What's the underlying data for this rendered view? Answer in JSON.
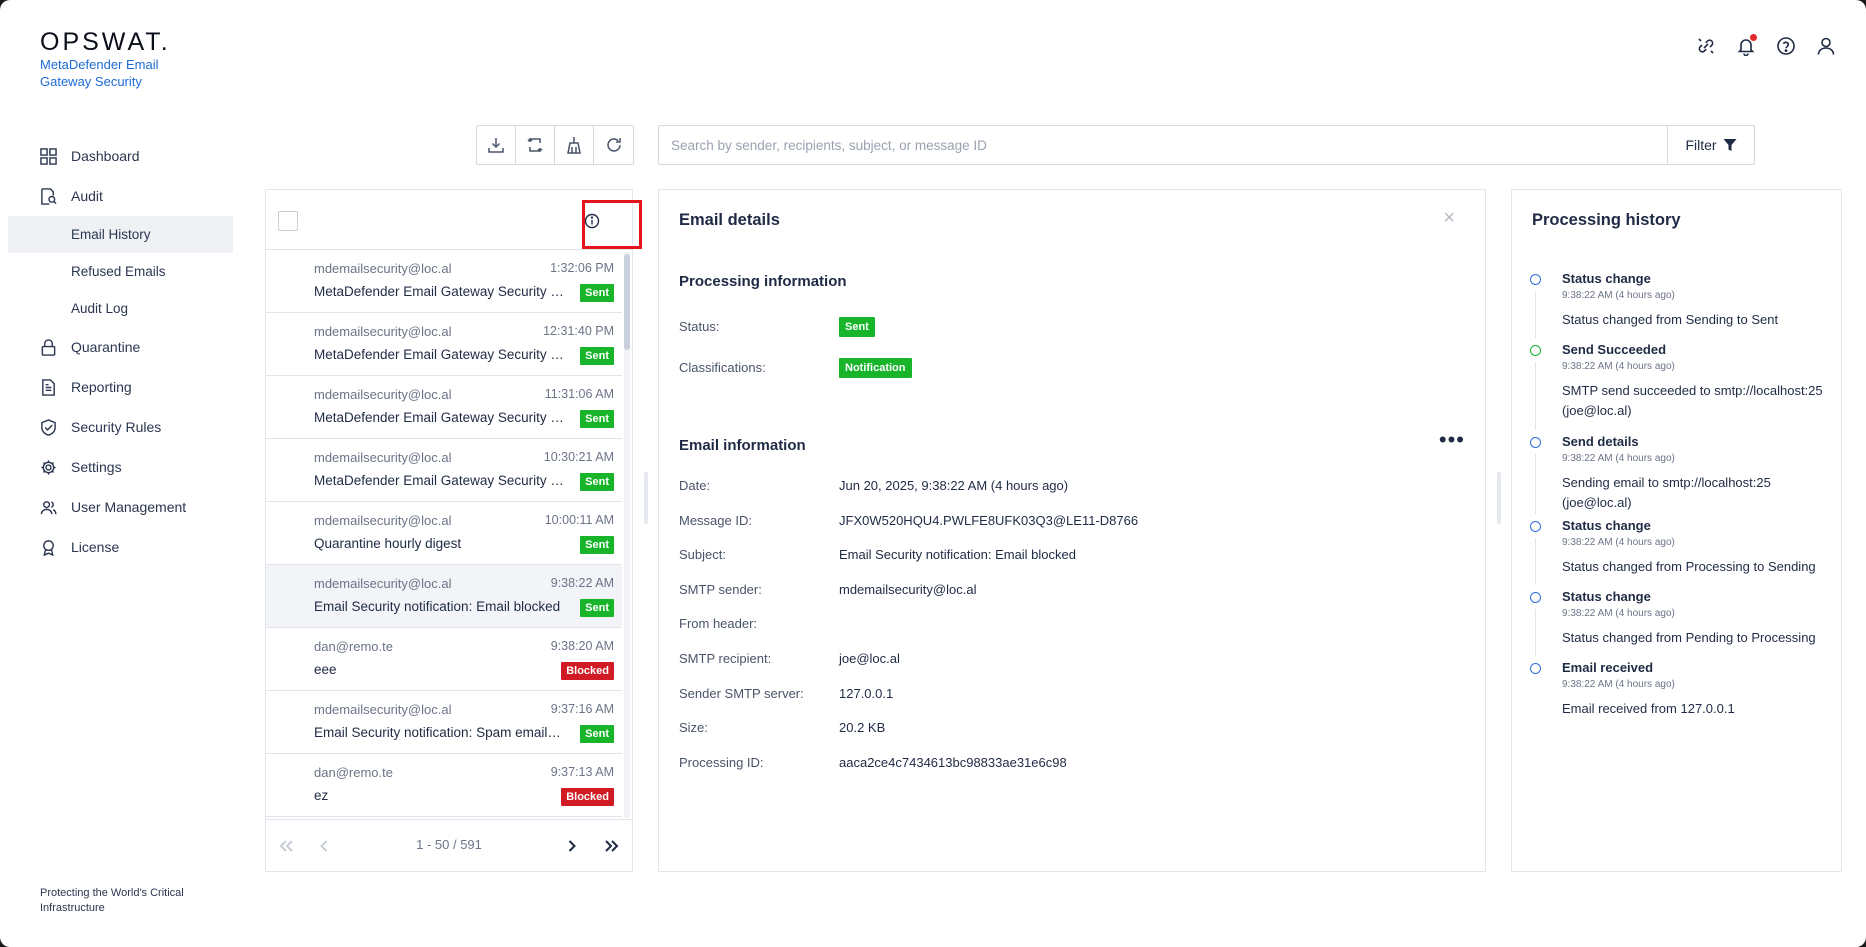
{
  "brand": {
    "logo": "OPSWAT",
    "logo_dot": ".",
    "product": "MetaDefender Email Gateway Security",
    "tagline": "Protecting the World's Critical Infrastructure"
  },
  "nav": {
    "dashboard": "Dashboard",
    "audit": "Audit",
    "email_history": "Email History",
    "refused_emails": "Refused Emails",
    "audit_log": "Audit Log",
    "quarantine": "Quarantine",
    "reporting": "Reporting",
    "security_rules": "Security Rules",
    "settings": "Settings",
    "user_management": "User Management",
    "license": "License"
  },
  "search": {
    "placeholder": "Search by sender, recipients, subject, or message ID",
    "filter_label": "Filter"
  },
  "emails": [
    {
      "from": "mdemailsecurity@loc.al",
      "time": "1:32:06 PM",
      "subject": "MetaDefender Email Gateway Security report",
      "status": "Sent"
    },
    {
      "from": "mdemailsecurity@loc.al",
      "time": "12:31:40 PM",
      "subject": "MetaDefender Email Gateway Security report",
      "status": "Sent"
    },
    {
      "from": "mdemailsecurity@loc.al",
      "time": "11:31:06 AM",
      "subject": "MetaDefender Email Gateway Security report",
      "status": "Sent"
    },
    {
      "from": "mdemailsecurity@loc.al",
      "time": "10:30:21 AM",
      "subject": "MetaDefender Email Gateway Security report",
      "status": "Sent"
    },
    {
      "from": "mdemailsecurity@loc.al",
      "time": "10:00:11 AM",
      "subject": "Quarantine hourly digest",
      "status": "Sent"
    },
    {
      "from": "mdemailsecurity@loc.al",
      "time": "9:38:22 AM",
      "subject": "Email Security notification: Email blocked",
      "status": "Sent"
    },
    {
      "from": "dan@remo.te",
      "time": "9:38:20 AM",
      "subject": "eee",
      "status": "Blocked"
    },
    {
      "from": "mdemailsecurity@loc.al",
      "time": "9:37:16 AM",
      "subject": "Email Security notification: Spam email detected",
      "status": "Sent"
    },
    {
      "from": "dan@remo.te",
      "time": "9:37:13 AM",
      "subject": "ez",
      "status": "Blocked"
    }
  ],
  "pager": {
    "count": "1 - 50 / 591"
  },
  "details": {
    "title": "Email details",
    "processing_title": "Processing information",
    "status_label": "Status:",
    "status_value": "Sent",
    "class_label": "Classifications:",
    "class_value": "Notification",
    "email_info_title": "Email information",
    "more": "•••",
    "fields": [
      {
        "label": "Date:",
        "value": "Jun 20, 2025, 9:38:22 AM (4 hours ago)"
      },
      {
        "label": "Message ID:",
        "value": "JFX0W520HQU4.PWLFE8UFK03Q3@LE11-D8766"
      },
      {
        "label": "Subject:",
        "value": "Email Security notification: Email blocked"
      },
      {
        "label": "SMTP sender:",
        "value": "mdemailsecurity@loc.al"
      },
      {
        "label": "From header:",
        "value": ""
      },
      {
        "label": "SMTP recipient:",
        "value": "joe@loc.al"
      },
      {
        "label": "Sender SMTP server:",
        "value": "127.0.0.1"
      },
      {
        "label": "Size:",
        "value": "20.2 KB"
      },
      {
        "label": "Processing ID:",
        "value": "aaca2ce4c7434613bc98833ae31e6c98"
      }
    ]
  },
  "history": {
    "title": "Processing history",
    "items": [
      {
        "title": "Status change",
        "time": "9:38:22 AM (4 hours ago)",
        "desc": "Status changed from Sending to Sent"
      },
      {
        "title": "Send Succeeded",
        "time": "9:38:22 AM (4 hours ago)",
        "desc": "SMTP send succeeded to smtp://localhost:25 (joe@loc.al)"
      },
      {
        "title": "Send details",
        "time": "9:38:22 AM (4 hours ago)",
        "desc": "Sending email to smtp://localhost:25 (joe@loc.al)"
      },
      {
        "title": "Status change",
        "time": "9:38:22 AM (4 hours ago)",
        "desc": "Status changed from Processing to Sending"
      },
      {
        "title": "Status change",
        "time": "9:38:22 AM (4 hours ago)",
        "desc": "Status changed from Pending to Processing"
      },
      {
        "title": "Email received",
        "time": "9:38:22 AM (4 hours ago)",
        "desc": "Email received from 127.0.0.1"
      }
    ]
  },
  "colors": {
    "accent": "#1d6bd6",
    "sent": "#18b52b",
    "blocked": "#d11b24",
    "highlight": "#e3141c"
  }
}
